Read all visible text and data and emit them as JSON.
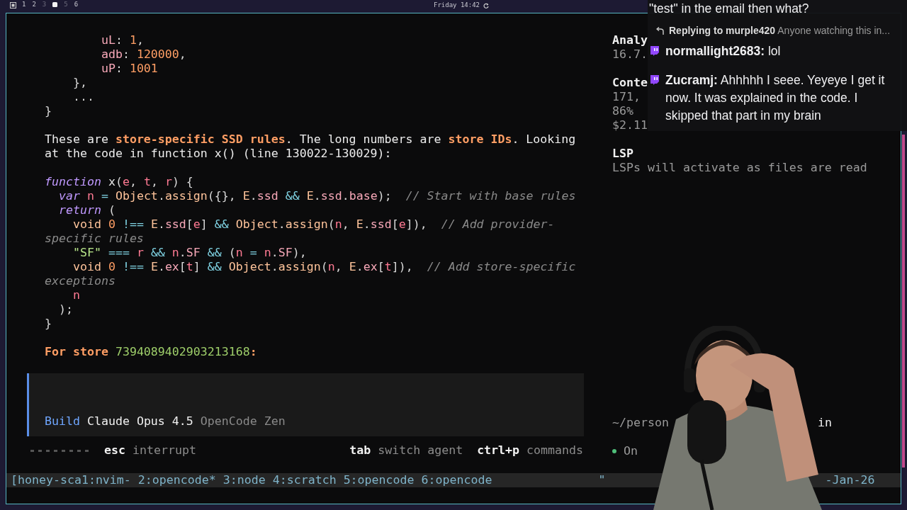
{
  "top_bar": {
    "workspaces": [
      {
        "label": "1",
        "occupied": true,
        "selected": false
      },
      {
        "label": "2",
        "occupied": true,
        "selected": false
      },
      {
        "label": "3",
        "occupied": false,
        "selected": false
      },
      {
        "selected": true
      },
      {
        "label": "5",
        "occupied": false,
        "selected": false
      },
      {
        "label": "6",
        "occupied": true,
        "selected": false
      }
    ],
    "clock": "Friday 14:42"
  },
  "transcript": [
    {
      "lines": [
        [
          {
            "text": "        uL",
            "kind": "prop"
          },
          {
            "text": ": ",
            "kind": "punct"
          },
          {
            "text": "1",
            "kind": "num"
          },
          {
            "text": ",",
            "kind": "punct"
          }
        ],
        [
          {
            "text": "        adb",
            "kind": "prop"
          },
          {
            "text": ": ",
            "kind": "punct"
          },
          {
            "text": "120000",
            "kind": "num"
          },
          {
            "text": ",",
            "kind": "punct"
          }
        ],
        [
          {
            "text": "        uP",
            "kind": "prop"
          },
          {
            "text": ": ",
            "kind": "punct"
          },
          {
            "text": "1001",
            "kind": "num"
          }
        ],
        [
          {
            "text": "    },",
            "kind": "punct"
          }
        ],
        [
          {
            "text": "    ...",
            "kind": "punct"
          }
        ],
        [
          {
            "text": "}",
            "kind": "punct"
          }
        ]
      ]
    },
    {
      "lines": [
        [
          {
            "text": "These are ",
            "kind": "plain"
          },
          {
            "text": "store-specific SSD rules",
            "kind": "em"
          },
          {
            "text": ". The long numbers are ",
            "kind": "plain"
          },
          {
            "text": "store IDs",
            "kind": "em"
          },
          {
            "text": ". Looking",
            "kind": "plain"
          }
        ],
        [
          {
            "text": "at the code in function x() (line 130022-130029):",
            "kind": "plain"
          }
        ]
      ]
    },
    {
      "lines": [
        [
          {
            "text": "function",
            "kind": "kw"
          },
          {
            "text": " x",
            "kind": "fn"
          },
          {
            "text": "(",
            "kind": "punct"
          },
          {
            "text": "e",
            "kind": "var"
          },
          {
            "text": ", ",
            "kind": "punct"
          },
          {
            "text": "t",
            "kind": "var"
          },
          {
            "text": ", ",
            "kind": "punct"
          },
          {
            "text": "r",
            "kind": "var"
          },
          {
            "text": ") {",
            "kind": "punct"
          }
        ],
        [
          {
            "text": "  var",
            "kind": "kw"
          },
          {
            "text": " n",
            "kind": "var"
          },
          {
            "text": " = ",
            "kind": "op"
          },
          {
            "text": "Object",
            "kind": "obj"
          },
          {
            "text": ".",
            "kind": "punct"
          },
          {
            "text": "assign",
            "kind": "obj"
          },
          {
            "text": "({}, ",
            "kind": "punct"
          },
          {
            "text": "E",
            "kind": "obj"
          },
          {
            "text": ".",
            "kind": "punct"
          },
          {
            "text": "ssd",
            "kind": "prop"
          },
          {
            "text": " && ",
            "kind": "op"
          },
          {
            "text": "E",
            "kind": "obj"
          },
          {
            "text": ".",
            "kind": "punct"
          },
          {
            "text": "ssd",
            "kind": "prop"
          },
          {
            "text": ".",
            "kind": "punct"
          },
          {
            "text": "base",
            "kind": "prop"
          },
          {
            "text": ");",
            "kind": "punct"
          },
          {
            "text": "  // Start with base rules",
            "kind": "cmt"
          }
        ],
        [
          {
            "text": "  return",
            "kind": "kw"
          },
          {
            "text": " (",
            "kind": "punct"
          }
        ],
        [
          {
            "text": "    void",
            "kind": "obj"
          },
          {
            "text": " 0",
            "kind": "num"
          },
          {
            "text": " !== ",
            "kind": "op"
          },
          {
            "text": "E",
            "kind": "obj"
          },
          {
            "text": ".",
            "kind": "punct"
          },
          {
            "text": "ssd",
            "kind": "prop"
          },
          {
            "text": "[",
            "kind": "punct"
          },
          {
            "text": "e",
            "kind": "var"
          },
          {
            "text": "]",
            "kind": "punct"
          },
          {
            "text": " && ",
            "kind": "op"
          },
          {
            "text": "Object",
            "kind": "obj"
          },
          {
            "text": ".",
            "kind": "punct"
          },
          {
            "text": "assign",
            "kind": "obj"
          },
          {
            "text": "(",
            "kind": "punct"
          },
          {
            "text": "n",
            "kind": "var"
          },
          {
            "text": ", ",
            "kind": "punct"
          },
          {
            "text": "E",
            "kind": "obj"
          },
          {
            "text": ".",
            "kind": "punct"
          },
          {
            "text": "ssd",
            "kind": "prop"
          },
          {
            "text": "[",
            "kind": "punct"
          },
          {
            "text": "e",
            "kind": "var"
          },
          {
            "text": "]),",
            "kind": "punct"
          },
          {
            "text": "  // Add provider-",
            "kind": "cmt"
          }
        ],
        [
          {
            "text": "specific rules",
            "kind": "cmt"
          }
        ],
        [
          {
            "text": "    \"SF\"",
            "kind": "str"
          },
          {
            "text": " === ",
            "kind": "op"
          },
          {
            "text": "r",
            "kind": "var"
          },
          {
            "text": " && ",
            "kind": "op"
          },
          {
            "text": "n",
            "kind": "var"
          },
          {
            "text": ".",
            "kind": "punct"
          },
          {
            "text": "SF",
            "kind": "prop"
          },
          {
            "text": " && ",
            "kind": "op"
          },
          {
            "text": "(",
            "kind": "punct"
          },
          {
            "text": "n",
            "kind": "var"
          },
          {
            "text": " = ",
            "kind": "op"
          },
          {
            "text": "n",
            "kind": "var"
          },
          {
            "text": ".",
            "kind": "punct"
          },
          {
            "text": "SF",
            "kind": "prop"
          },
          {
            "text": "),",
            "kind": "punct"
          }
        ],
        [
          {
            "text": "    void",
            "kind": "obj"
          },
          {
            "text": " 0",
            "kind": "num"
          },
          {
            "text": " !== ",
            "kind": "op"
          },
          {
            "text": "E",
            "kind": "obj"
          },
          {
            "text": ".",
            "kind": "punct"
          },
          {
            "text": "ex",
            "kind": "prop"
          },
          {
            "text": "[",
            "kind": "punct"
          },
          {
            "text": "t",
            "kind": "var"
          },
          {
            "text": "]",
            "kind": "punct"
          },
          {
            "text": " && ",
            "kind": "op"
          },
          {
            "text": "Object",
            "kind": "obj"
          },
          {
            "text": ".",
            "kind": "punct"
          },
          {
            "text": "assign",
            "kind": "obj"
          },
          {
            "text": "(",
            "kind": "punct"
          },
          {
            "text": "n",
            "kind": "var"
          },
          {
            "text": ", ",
            "kind": "punct"
          },
          {
            "text": "E",
            "kind": "obj"
          },
          {
            "text": ".",
            "kind": "punct"
          },
          {
            "text": "ex",
            "kind": "prop"
          },
          {
            "text": "[",
            "kind": "punct"
          },
          {
            "text": "t",
            "kind": "var"
          },
          {
            "text": "]),",
            "kind": "punct"
          },
          {
            "text": "  // Add store-specific",
            "kind": "cmt"
          }
        ],
        [
          {
            "text": "exceptions",
            "kind": "cmt"
          }
        ],
        [
          {
            "text": "    n",
            "kind": "var"
          }
        ],
        [
          {
            "text": "  );",
            "kind": "punct"
          }
        ],
        [
          {
            "text": "}",
            "kind": "punct"
          }
        ]
      ]
    },
    {
      "lines": [
        [
          {
            "text": "For store ",
            "kind": "em"
          },
          {
            "text": "7394089402903213168",
            "kind": "hl"
          },
          {
            "text": ":",
            "kind": "em"
          }
        ]
      ]
    }
  ],
  "prompt": {
    "mode": "Build",
    "model": "Claude Opus 4.5",
    "provider": "OpenCode Zen"
  },
  "hints": {
    "left": [
      {
        "key": "esc",
        "label": "interrupt"
      }
    ],
    "right": [
      {
        "key": "tab",
        "label": "switch agent"
      },
      {
        "key": "ctrl+p",
        "label": "commands"
      }
    ]
  },
  "sidebar": {
    "sections": [
      {
        "heading": "Analy",
        "lines": [
          "16.7."
        ]
      },
      {
        "heading": "Conte",
        "lines": [
          "171,",
          "86%",
          "$2.11"
        ]
      },
      {
        "heading": "LSP",
        "lines": [
          "LSPs will activate as files are read"
        ]
      }
    ],
    "path_start": "~/person",
    "path_end": "in",
    "status": "On"
  },
  "tmux": {
    "windows": [
      "[honey-sca1:nvim-",
      "2:opencode*",
      "3:node",
      "4:scratch",
      "5:opencode",
      "6:opencode"
    ],
    "right_start": "\"",
    "right_end": "-Jan-26"
  },
  "chat": [
    {
      "kind": "text",
      "text": "\"test\" in the email then what?"
    },
    {
      "kind": "reply",
      "user": "Replying to murple420",
      "text": "Anyone watching this in..."
    },
    {
      "kind": "message",
      "user": "normallight2683:",
      "text": "lol"
    },
    {
      "kind": "message",
      "user": "Zucramj:",
      "text": "Ahhhhh I seee. Yeyeye I get it now. It was explained in the code. I skipped that part in my brain"
    }
  ]
}
